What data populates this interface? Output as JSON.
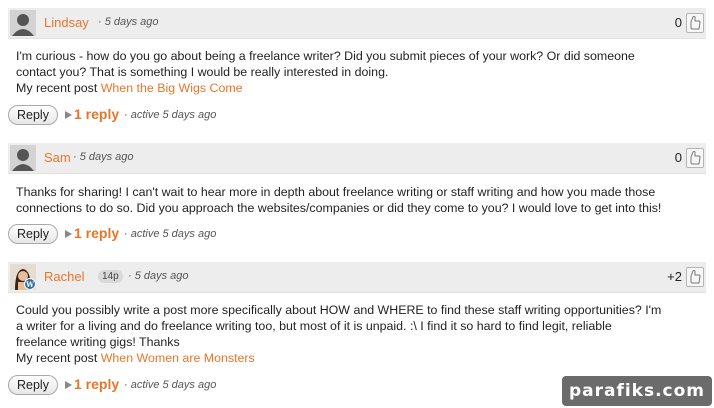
{
  "comments": [
    {
      "author": "Lindsay",
      "time": "· 5 days ago",
      "points": "0",
      "body_lines": [
        "I'm curious - how do you go about being a freelance writer? Did you submit pieces of your work? Or did someone",
        "contact you? That is something I would be really interested in doing."
      ],
      "recent_prefix": "My recent post",
      "recent_link": "When the Big Wigs Come",
      "reply_label": "Reply",
      "replies": "1 reply",
      "active": "· active 5 days ago",
      "avatar_icon": "default-user-icon"
    },
    {
      "author": "Sam",
      "time": "· 5 days ago",
      "points": "0",
      "body_lines": [
        "Thanks for sharing! I can't wait to hear more in depth about freelance writing or staff writing and how you made those",
        "connections to do so. Did you approach the websites/companies or did they come to you? I would love to get into this!"
      ],
      "reply_label": "Reply",
      "replies": "1 reply",
      "active": "· active 5 days ago",
      "avatar_icon": "default-user-icon"
    },
    {
      "author": "Rachel",
      "badge": "14p",
      "time": "· 5 days ago",
      "points": "+2",
      "body_lines": [
        "Could you possibly write a post more specifically about HOW and WHERE to find these staff writing opportunities? I'm",
        "a writer for a living and do freelance writing too, but most of it is unpaid. :\\ I find it so hard to find legit, reliable",
        "freelance writing gigs! Thanks"
      ],
      "recent_prefix": "My recent post",
      "recent_link": "When Women are Monsters",
      "reply_label": "Reply",
      "replies": "1 reply",
      "active": "· active 5 days ago",
      "avatar_icon": "photo-avatar-with-wordpress-icon"
    }
  ],
  "watermark": "parafiks.com",
  "colors": {
    "accent": "#e8762a",
    "header_bg": "#ededed"
  }
}
